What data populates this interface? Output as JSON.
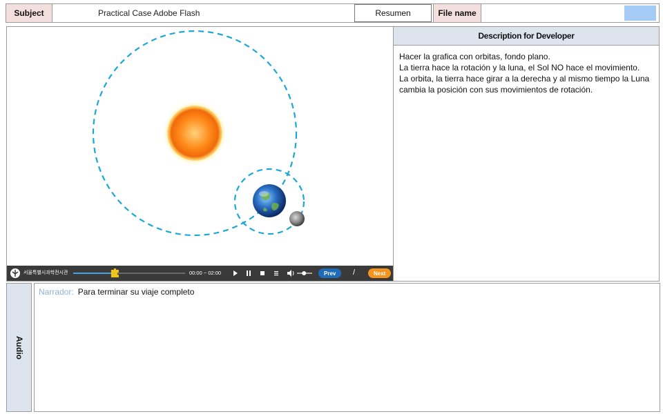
{
  "header": {
    "subject_label": "Subject",
    "subject_value": "Practical Case Adobe Flash",
    "resumen_label": "Resumen",
    "filename_label": "File name",
    "filename_value": ""
  },
  "player": {
    "logo_text": "서울특별시과학전시관",
    "progress_fraction": 0.37,
    "time_text": "00:00 ~ 02:00",
    "volume_fraction": 0.45,
    "prev_label": "Prev",
    "separator": "/",
    "next_label": "Next",
    "colors": {
      "bar_bg": "#3a3a3a",
      "accent": "#f7941d",
      "prev": "#1e6bb8",
      "orbit": "#1aa7d8"
    }
  },
  "description": {
    "title": "Description for Developer",
    "lines": [
      "Hacer la grafica con orbitas, fondo plano.",
      "La tierra hace la rotación y la luna, el Sol NO hace el movimiento.",
      "La orbita,  la tierra hace girar a la derecha  y al mismo tiempo la Luna cambia la posición con sus movimientos de rotación."
    ]
  },
  "audio": {
    "tab_label": "Audio",
    "narrator_label": "Narrador:",
    "narrator_text": "Para terminar su viaje completo"
  }
}
